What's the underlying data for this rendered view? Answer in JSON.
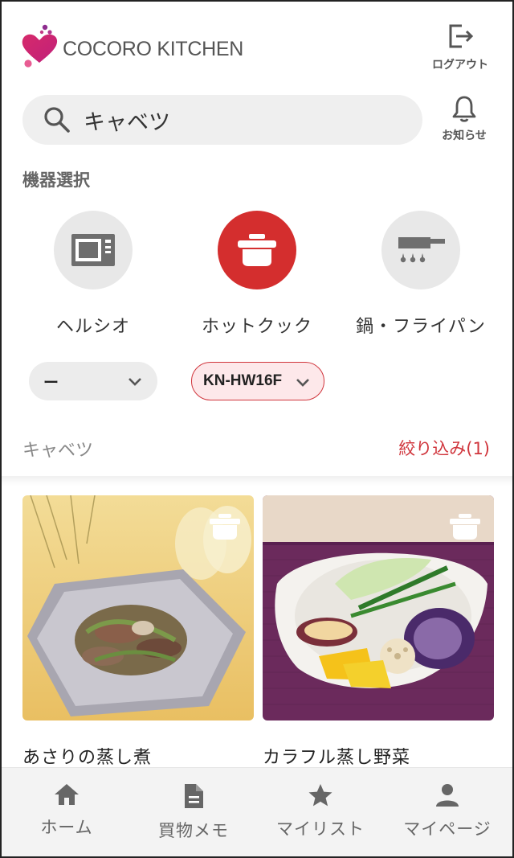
{
  "header": {
    "brand": "COCORO KITCHEN",
    "logout_label": "ログアウト",
    "notice_label": "お知らせ"
  },
  "search": {
    "value": "キャベツ"
  },
  "device_section": {
    "title": "機器選択",
    "devices": [
      {
        "name": "ヘルシオ",
        "icon": "microwave-icon",
        "active": false
      },
      {
        "name": "ホットクック",
        "icon": "pot-icon",
        "active": true
      },
      {
        "name": "鍋・フライパン",
        "icon": "pan-icon",
        "active": false
      }
    ]
  },
  "model_selectors": {
    "healsio_value": "ー",
    "hotcook_value": "KN-HW16F"
  },
  "results": {
    "keyword": "キャベツ",
    "filter_label": "絞り込み(1)"
  },
  "recipes": [
    {
      "title": "あさりの蒸し煮",
      "badge_icon": "pot-icon"
    },
    {
      "title": "カラフル蒸し野菜",
      "badge_icon": "pot-icon"
    }
  ],
  "bottom_nav": [
    {
      "label": "ホーム",
      "icon": "home-icon"
    },
    {
      "label": "買物メモ",
      "icon": "document-icon"
    },
    {
      "label": "マイリスト",
      "icon": "star-icon"
    },
    {
      "label": "マイページ",
      "icon": "person-icon"
    }
  ],
  "colors": {
    "accent": "#d42e2e",
    "accent_light": "#fde8ea",
    "logo_pink": "#e6307a"
  }
}
